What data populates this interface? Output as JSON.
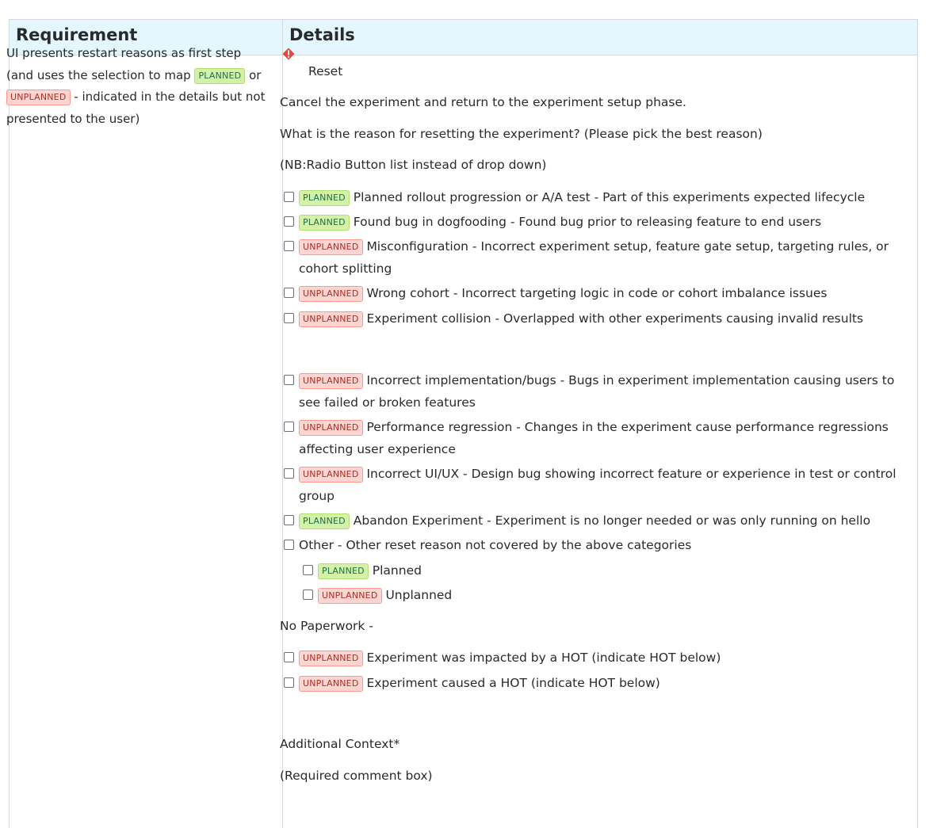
{
  "headers": {
    "requirement": "Requirement",
    "details": "Details"
  },
  "requirement": {
    "part1": "UI presents restart reasons as first step (and uses the selection to map ",
    "planned": "PLANNED",
    "part2": " or ",
    "unplanned": "UNPLANNED",
    "part3": " - indicated in the details but not presented to the user)"
  },
  "details": {
    "reset_label": "Reset",
    "cancel_text": "Cancel the experiment and return to the experiment setup phase.",
    "question": "What is the reason for resetting the experiment? (Please pick the best reason)",
    "nb": "(NB:Radio Button list instead of drop down)",
    "options": [
      {
        "tag": "PLANNED",
        "text": "Planned rollout progression or A/A test  - Part of this experiments expected lifecycle"
      },
      {
        "tag": "PLANNED",
        "text": "Found bug in dogfooding - Found bug prior to releasing feature to end users"
      },
      {
        "tag": "UNPLANNED",
        "text": "Misconfiguration - Incorrect experiment setup, feature gate setup, targeting rules, or cohort splitting"
      },
      {
        "tag": "UNPLANNED",
        "text": "Wrong cohort - Incorrect targeting logic in code or cohort imbalance issues"
      },
      {
        "tag": "UNPLANNED",
        "text": "Experiment collision - Overlapped with other experiments causing invalid results"
      },
      {
        "tag": "UNPLANNED",
        "text": "Incorrect implementation/bugs - Bugs in experiment implementation causing users to see failed or broken features"
      },
      {
        "tag": "UNPLANNED",
        "text": "Performance regression - Changes in the experiment cause performance regressions affecting user experience"
      },
      {
        "tag": "UNPLANNED",
        "text": "Incorrect UI/UX - Design bug showing incorrect feature or experience in test or control group"
      },
      {
        "tag": "PLANNED",
        "text": "Abandon Experiment - Experiment is no longer needed or was only running on hello"
      },
      {
        "tag": "",
        "text": "Other - Other reset reason not covered by the above categories"
      }
    ],
    "other_sub": [
      {
        "tag": "PLANNED",
        "text": "Planned"
      },
      {
        "tag": "UNPLANNED",
        "text": "Unplanned"
      }
    ],
    "no_paperwork": "No Paperwork -",
    "hot_options": [
      {
        "tag": "UNPLANNED",
        "text": "Experiment was impacted by a HOT (indicate HOT below)"
      },
      {
        "tag": "UNPLANNED",
        "text": "Experiment caused a HOT (indicate HOT below)"
      }
    ],
    "additional_context": "Additional Context*",
    "required_box": "(Required comment box)"
  },
  "colors": {
    "header_bg": "#e4f6fe",
    "planned_bg": "#d3f1a7",
    "unplanned_bg": "#ffd5d2",
    "warning_icon": "#e2483d"
  }
}
